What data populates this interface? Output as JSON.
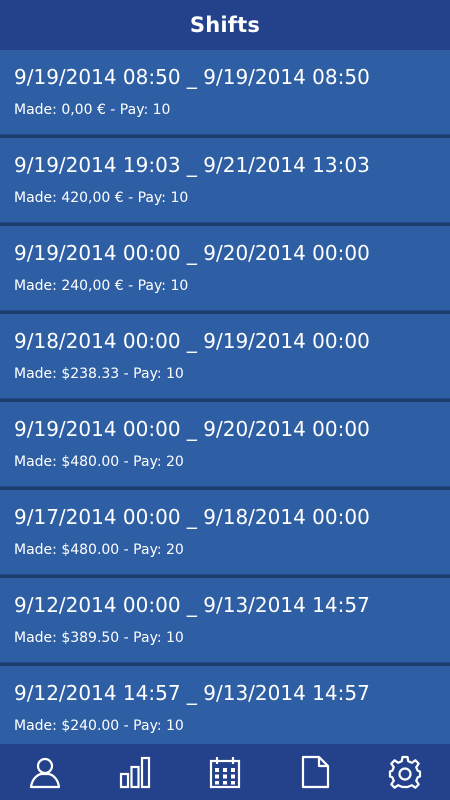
{
  "header": {
    "title": "Shifts"
  },
  "shifts": [
    {
      "range": "9/19/2014 08:50 _ 9/19/2014 08:50",
      "made": "Made: 0,00 € - Pay: 10"
    },
    {
      "range": "9/19/2014 19:03 _ 9/21/2014 13:03",
      "made": "Made: 420,00 € - Pay: 10"
    },
    {
      "range": "9/19/2014 00:00 _ 9/20/2014 00:00",
      "made": "Made: 240,00 € - Pay: 10"
    },
    {
      "range": "9/18/2014 00:00 _ 9/19/2014 00:00",
      "made": "Made: $238.33 - Pay: 10"
    },
    {
      "range": "9/19/2014 00:00 _ 9/20/2014 00:00",
      "made": "Made: $480.00 - Pay: 20"
    },
    {
      "range": "9/17/2014 00:00 _ 9/18/2014 00:00",
      "made": "Made: $480.00 - Pay: 20"
    },
    {
      "range": "9/12/2014 00:00 _ 9/13/2014 14:57",
      "made": "Made: $389.50 - Pay: 10"
    },
    {
      "range": "9/12/2014 14:57 _ 9/13/2014 14:57",
      "made": "Made: $240.00 - Pay: 10"
    }
  ],
  "tabs": [
    {
      "name": "profile",
      "icon": "person-icon"
    },
    {
      "name": "stats",
      "icon": "bar-chart-icon"
    },
    {
      "name": "calendar",
      "icon": "calendar-icon"
    },
    {
      "name": "documents",
      "icon": "document-icon"
    },
    {
      "name": "settings",
      "icon": "gear-icon"
    }
  ],
  "colors": {
    "header": "#23428b",
    "item": "#2e5ea3",
    "divider": "#1f3d6b",
    "text": "#ffffff"
  }
}
